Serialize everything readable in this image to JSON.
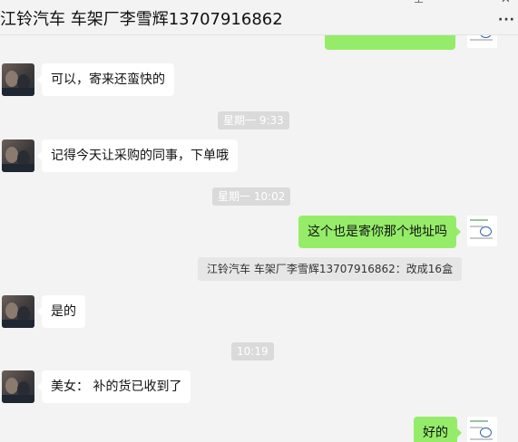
{
  "header": {
    "title": "江铃汽车 车架厂李雪辉13707916862",
    "more_label": "···"
  },
  "messages": [
    {
      "kind": "in",
      "text": "可以，寄来还蛮快的"
    },
    {
      "kind": "time",
      "text": "星期一 9:33"
    },
    {
      "kind": "in",
      "text": "记得今天让采购的同事，下单哦"
    },
    {
      "kind": "time",
      "text": "星期一 10:02"
    },
    {
      "kind": "out",
      "text": "这个也是寄你那个地址吗"
    },
    {
      "kind": "note",
      "text": "江铃汽车 车架厂李雪辉13707916862：改成16盒"
    },
    {
      "kind": "in",
      "text": "是的"
    },
    {
      "kind": "time",
      "text": "10:19"
    },
    {
      "kind": "in",
      "text": "美女： 补的货已收到了"
    },
    {
      "kind": "out",
      "text": "好的"
    }
  ]
}
